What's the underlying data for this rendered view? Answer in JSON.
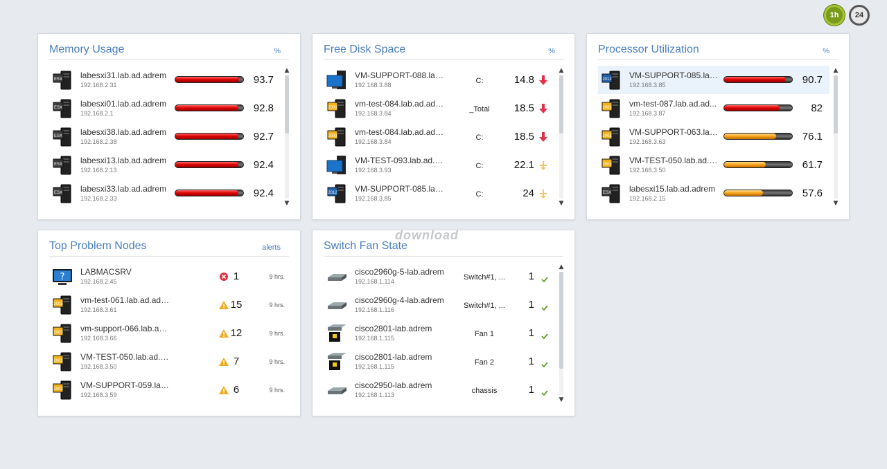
{
  "toolbar": {
    "btn_1h": "1h",
    "btn_24": "24"
  },
  "watermark": "download",
  "memory": {
    "title": "Memory Usage",
    "unit": "%",
    "rows": [
      {
        "name": "labesxi31.lab.ad.adrem",
        "ip": "192.168.2.31",
        "value": "93.7",
        "level": 0.937,
        "color": "red",
        "icon": "esx-server-icon"
      },
      {
        "name": "labesxi01.lab.ad.adrem",
        "ip": "192.168.2.1",
        "value": "92.8",
        "level": 0.928,
        "color": "red",
        "icon": "esx-server-icon"
      },
      {
        "name": "labesxi38.lab.ad.adrem",
        "ip": "192.168.2.38",
        "value": "92.7",
        "level": 0.927,
        "color": "red",
        "icon": "esx-server-icon"
      },
      {
        "name": "labesxi13.lab.ad.adrem",
        "ip": "192.168.2.13",
        "value": "92.4",
        "level": 0.924,
        "color": "red",
        "icon": "esx-server-icon"
      },
      {
        "name": "labesxi33.lab.ad.adrem",
        "ip": "192.168.2.33",
        "value": "92.4",
        "level": 0.924,
        "color": "red",
        "icon": "esx-server-icon"
      }
    ]
  },
  "disk": {
    "title": "Free Disk Space",
    "unit": "%",
    "rows": [
      {
        "name": "VM-SUPPORT-088.lab.a...",
        "ip": "192.168.3.88",
        "drive": "C:",
        "value": "14.8",
        "trend": "down",
        "icon": "windows-desktop-icon"
      },
      {
        "name": "vm-test-084.lab.ad.adre...",
        "ip": "192.168.3.84",
        "drive": "_Total",
        "value": "18.5",
        "trend": "down",
        "icon": "windows-server-2003-icon"
      },
      {
        "name": "vm-test-084.lab.ad.adre...",
        "ip": "192.168.3.84",
        "drive": "C:",
        "value": "18.5",
        "trend": "down",
        "icon": "windows-server-2003-icon"
      },
      {
        "name": "VM-TEST-093.lab.ad.adr...",
        "ip": "192.168.3.93",
        "drive": "C:",
        "value": "22.1",
        "trend": "flat",
        "icon": "windows-desktop-icon"
      },
      {
        "name": "VM-SUPPORT-085.lab.a...",
        "ip": "192.168.3.85",
        "drive": "C:",
        "value": "24",
        "trend": "flat",
        "icon": "windows-server-2012-icon"
      }
    ]
  },
  "cpu": {
    "title": "Processor Utilization",
    "unit": "%",
    "rows": [
      {
        "name": "VM-SUPPORT-085.lab...",
        "ip": "192.168.3.85",
        "value": "90.7",
        "level": 0.907,
        "color": "red",
        "icon": "windows-server-2012-icon"
      },
      {
        "name": "vm-test-087.lab.ad.ad...",
        "ip": "192.168.3.87",
        "value": "82",
        "level": 0.82,
        "color": "red",
        "icon": "windows-server-2003-icon"
      },
      {
        "name": "VM-SUPPORT-063.lab...",
        "ip": "192.168.3.63",
        "value": "76.1",
        "level": 0.761,
        "color": "orange",
        "icon": "windows-server-2003-icon"
      },
      {
        "name": "VM-TEST-050.lab.ad.a...",
        "ip": "192.168.3.50",
        "value": "61.7",
        "level": 0.617,
        "color": "orange",
        "icon": "windows-server-2003-icon"
      },
      {
        "name": "labesxi15.lab.ad.adrem",
        "ip": "192.168.2.15",
        "value": "57.6",
        "level": 0.576,
        "color": "orange",
        "icon": "esx-server-icon"
      }
    ]
  },
  "problems": {
    "title": "Top Problem Nodes",
    "unit": "alerts",
    "rows": [
      {
        "name": "LABMACSRV",
        "ip": "192.168.2.45",
        "state": "error",
        "count": "1",
        "time": "9 hrs.",
        "icon": "monitor-question-icon"
      },
      {
        "name": "vm-test-061.lab.ad.adrem",
        "ip": "192.168.3.61",
        "state": "warning",
        "count": "15",
        "time": "9 hrs.",
        "icon": "windows-server-2003-icon"
      },
      {
        "name": "vm-support-066.lab.ad.a...",
        "ip": "192.168.3.66",
        "state": "warning",
        "count": "12",
        "time": "9 hrs.",
        "icon": "windows-server-2003-icon"
      },
      {
        "name": "VM-TEST-050.lab.ad.adr...",
        "ip": "192.168.3.50",
        "state": "warning",
        "count": "7",
        "time": "9 hrs.",
        "icon": "windows-server-2003-icon"
      },
      {
        "name": "VM-SUPPORT-059.lab.a...",
        "ip": "192.168.3.59",
        "state": "warning",
        "count": "6",
        "time": "9 hrs.",
        "icon": "windows-server-2003-icon"
      }
    ]
  },
  "fans": {
    "title": "Switch Fan State",
    "rows": [
      {
        "name": "cisco2960g-5-lab.adrem",
        "ip": "192.168.1.114",
        "status": "Switch#1, ...",
        "value": "1",
        "icon": "cisco-switch-icon"
      },
      {
        "name": "cisco2960g-4-lab.adrem",
        "ip": "192.168.1.116",
        "status": "Switch#1, ...",
        "value": "1",
        "icon": "cisco-switch-icon"
      },
      {
        "name": "cisco2801-lab.adrem",
        "ip": "192.168.1.115",
        "status": "Fan 1",
        "value": "1",
        "icon": "cisco-router-icon"
      },
      {
        "name": "cisco2801-lab.adrem",
        "ip": "192.168.1.115",
        "status": "Fan 2",
        "value": "1",
        "icon": "cisco-router-icon"
      },
      {
        "name": "cisco2950-lab.adrem",
        "ip": "192.168.1.113",
        "status": "chassis",
        "value": "1",
        "icon": "cisco-switch-icon"
      }
    ]
  }
}
